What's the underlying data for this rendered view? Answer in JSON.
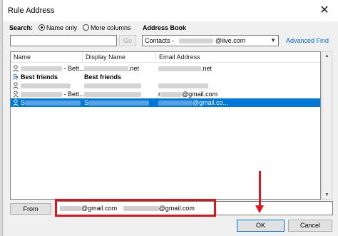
{
  "window": {
    "title": "Rule Address",
    "close_glyph": "✕"
  },
  "search": {
    "label": "Search:",
    "options": [
      "Name only",
      "More columns"
    ],
    "selected": "Name only",
    "query": "",
    "go_label": "Go"
  },
  "address_book": {
    "label": "Address Book",
    "selected_prefix": "Contacts -",
    "selected_suffix": "@live.com",
    "advanced_find_label": "Advanced Find"
  },
  "table": {
    "columns": [
      "Name",
      "Display Name",
      "Email Address"
    ],
    "rows": [
      {
        "icon": "person-icon",
        "name_suffix": "- Bett...",
        "display_suffix": ".net",
        "email_suffix": ".net",
        "bold": false,
        "selected": false
      },
      {
        "icon": "group-icon",
        "name": "Best friends",
        "display": "Best friends",
        "email": "",
        "bold": true,
        "selected": false
      },
      {
        "icon": "person-icon",
        "name_suffix": "",
        "display_suffix": "",
        "email_suffix": "",
        "bold": false,
        "selected": false
      },
      {
        "icon": "person-icon",
        "name_suffix": "- Bett...",
        "display_suffix": "",
        "email_prefix": "r",
        "email_suffix": "@gmail.com",
        "bold": false,
        "selected": false
      },
      {
        "icon": "person-icon",
        "name_prefix": "S",
        "name_suffix": "",
        "display_prefix": "S",
        "display_suffix": "",
        "email_suffix": "@gmail.co...",
        "bold": false,
        "selected": true
      }
    ]
  },
  "from": {
    "button_label": "From",
    "value_part1": "@gmail.com",
    "value_part2": "@gmail.com"
  },
  "actions": {
    "ok_label": "OK",
    "cancel_label": "Cancel"
  },
  "colors": {
    "annotation": "#e0141b",
    "selection": "#0078d7",
    "link": "#0066cc"
  }
}
